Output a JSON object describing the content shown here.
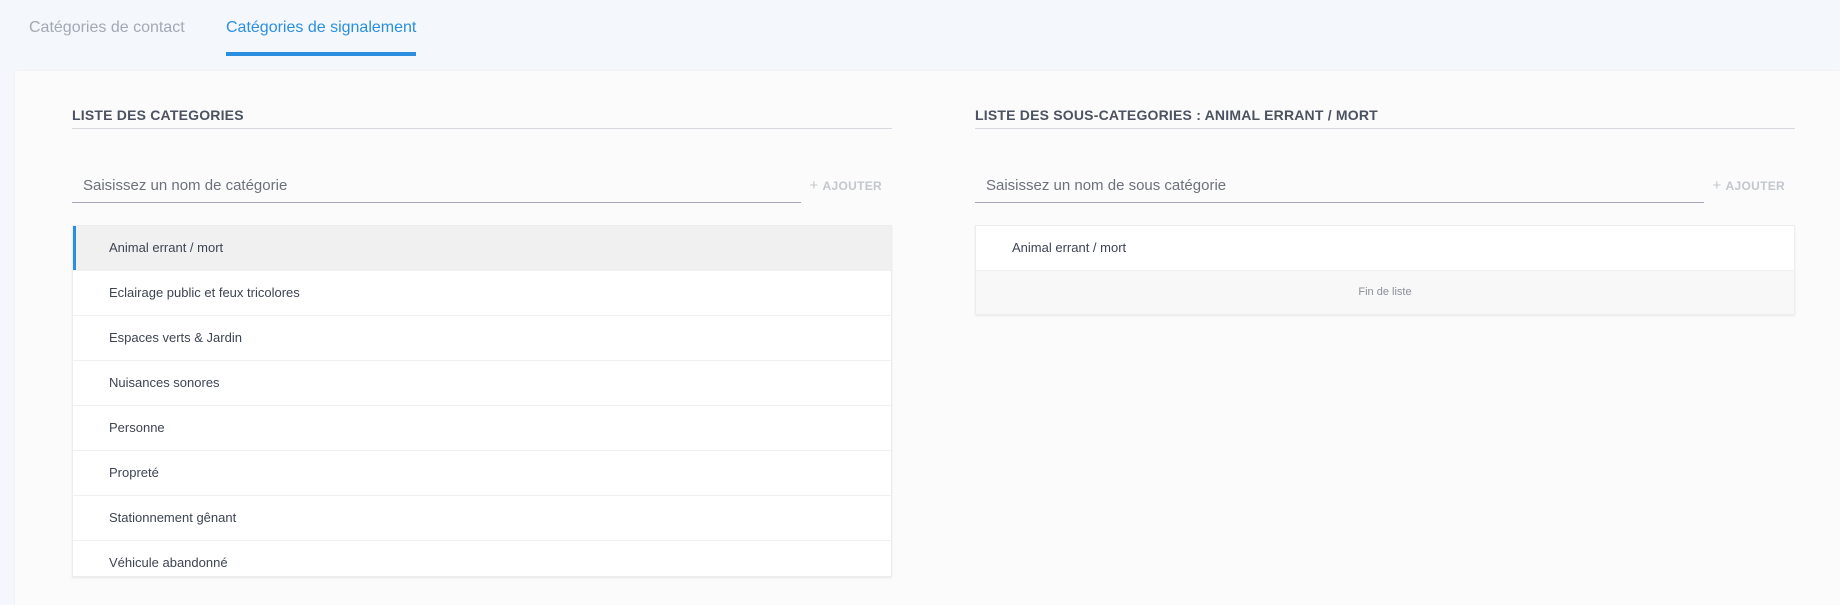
{
  "tabs": {
    "contact": "Catégories de contact",
    "report": "Catégories de signalement"
  },
  "categories": {
    "title": "LISTE DES CATEGORIES",
    "placeholder": "Saisissez un nom de catégorie",
    "add_label": "AJOUTER",
    "items": [
      "Animal errant / mort",
      "Eclairage public et feux tricolores",
      "Espaces verts & Jardin",
      "Nuisances sonores",
      "Personne",
      "Propreté",
      "Stationnement gênant",
      "Véhicule abandonné"
    ]
  },
  "subcategories": {
    "title": "LISTE DES SOUS-CATEGORIES : ANIMAL ERRANT / MORT",
    "placeholder": "Saisissez un nom de sous catégorie",
    "add_label": "AJOUTER",
    "items": [
      "Animal errant / mort"
    ],
    "end_label": "Fin de liste"
  },
  "colors": {
    "accent": "#2b8fe0"
  }
}
